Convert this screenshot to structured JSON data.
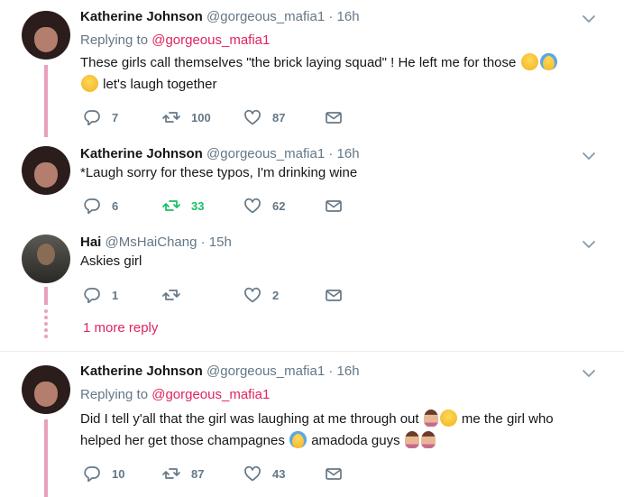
{
  "tweets": [
    {
      "name": "Katherine Johnson",
      "handle": "@gorgeous_mafia1",
      "sep": "·",
      "time": "16h",
      "reply_prefix": "Replying to ",
      "reply_to": "@gorgeous_mafia1",
      "line1": "These girls call themselves \"the brick laying squad\" ! He left me for those",
      "line2": "let's laugh together",
      "replies": "7",
      "retweets": "100",
      "likes": "87"
    },
    {
      "name": "Katherine Johnson",
      "handle": "@gorgeous_mafia1",
      "sep": "·",
      "time": "16h",
      "text": "*Laugh sorry for these typos, I'm drinking wine",
      "replies": "6",
      "retweets": "33",
      "likes": "62"
    },
    {
      "name": "Hai",
      "handle": "@MsHaiChang",
      "sep": "·",
      "time": "15h",
      "text": "Askies girl",
      "replies": "1",
      "retweets": "",
      "likes": "2"
    },
    {
      "name": "Katherine Johnson",
      "handle": "@gorgeous_mafia1",
      "sep": "·",
      "time": "16h",
      "reply_prefix": "Replying to ",
      "reply_to": "@gorgeous_mafia1",
      "line1a": "Did I tell y'all that the girl was laughing at me through out",
      "line1b": "me the girl who",
      "line2a": "helped her get those champagnes",
      "line2b": "amadoda guys",
      "replies": "10",
      "retweets": "87",
      "likes": "43"
    }
  ],
  "more_reply": "1 more reply",
  "colors": {
    "accent": "#e0245e",
    "thread": "#ea9fbd",
    "retweet_active": "#17bf63",
    "muted": "#657786"
  },
  "icons": [
    "chevron-down-icon",
    "reply-icon",
    "retweet-icon",
    "like-icon",
    "dm-icon"
  ]
}
